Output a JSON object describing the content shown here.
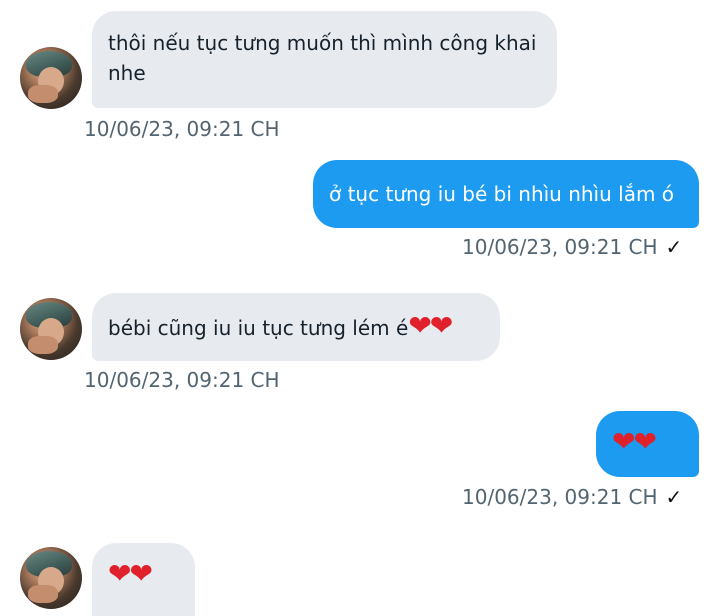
{
  "messages": [
    {
      "direction": "incoming",
      "text": "thôi nếu tục tưng muốn thì mình công khai nhe",
      "timestamp": "10/06/23,  09:21 CH"
    },
    {
      "direction": "outgoing",
      "text": "ở tục tưng iu bé bi nhìu nhìu lắm ó",
      "timestamp": "10/06/23,  09:21 CH",
      "status_icon": "check-icon"
    },
    {
      "direction": "incoming",
      "text": "bébi cũng iu iu tục tưng lém é",
      "emoji": "❤❤",
      "timestamp": "10/06/23,  09:21 CH"
    },
    {
      "direction": "outgoing",
      "emoji": "❤❤",
      "timestamp": "10/06/23,  09:21 CH",
      "status_icon": "check-icon"
    },
    {
      "direction": "incoming",
      "emoji": "❤❤"
    }
  ],
  "check_glyph": "✓",
  "colors": {
    "incoming_bubble": "#e7ebf0",
    "outgoing_bubble": "#1d9bf0",
    "timestamp": "#536471",
    "heart": "#e0202b"
  }
}
